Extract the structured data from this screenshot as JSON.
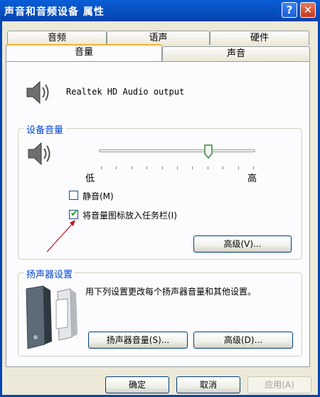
{
  "window": {
    "title": "声音和音频设备 属性",
    "help_glyph": "?",
    "close_glyph": "✕"
  },
  "tabs_back": [
    "音频",
    "语声",
    "硬件"
  ],
  "tabs_front": [
    "音量",
    "声音"
  ],
  "device": {
    "name": "Realtek HD Audio output"
  },
  "device_volume": {
    "label": "设备音量",
    "low_label": "低",
    "high_label": "高",
    "level_fraction": 0.7,
    "mute_label": "静音(M)",
    "mute_checked": false,
    "tray_label": "将音量图标放入任务栏(I)",
    "tray_checked": true,
    "advanced_label": "高级(V)..."
  },
  "speaker": {
    "label": "扬声器设置",
    "description": "用下列设置更改每个扬声器音量和其他设置。",
    "volume_button": "扬声器音量(S)...",
    "advanced_button": "高级(D)..."
  },
  "footer": {
    "ok": "确定",
    "cancel": "取消",
    "apply": "应用(A)"
  },
  "colors": {
    "accent": "#0446b2",
    "group_label": "#0046d5",
    "annotation_arrow": "#c0141b"
  }
}
